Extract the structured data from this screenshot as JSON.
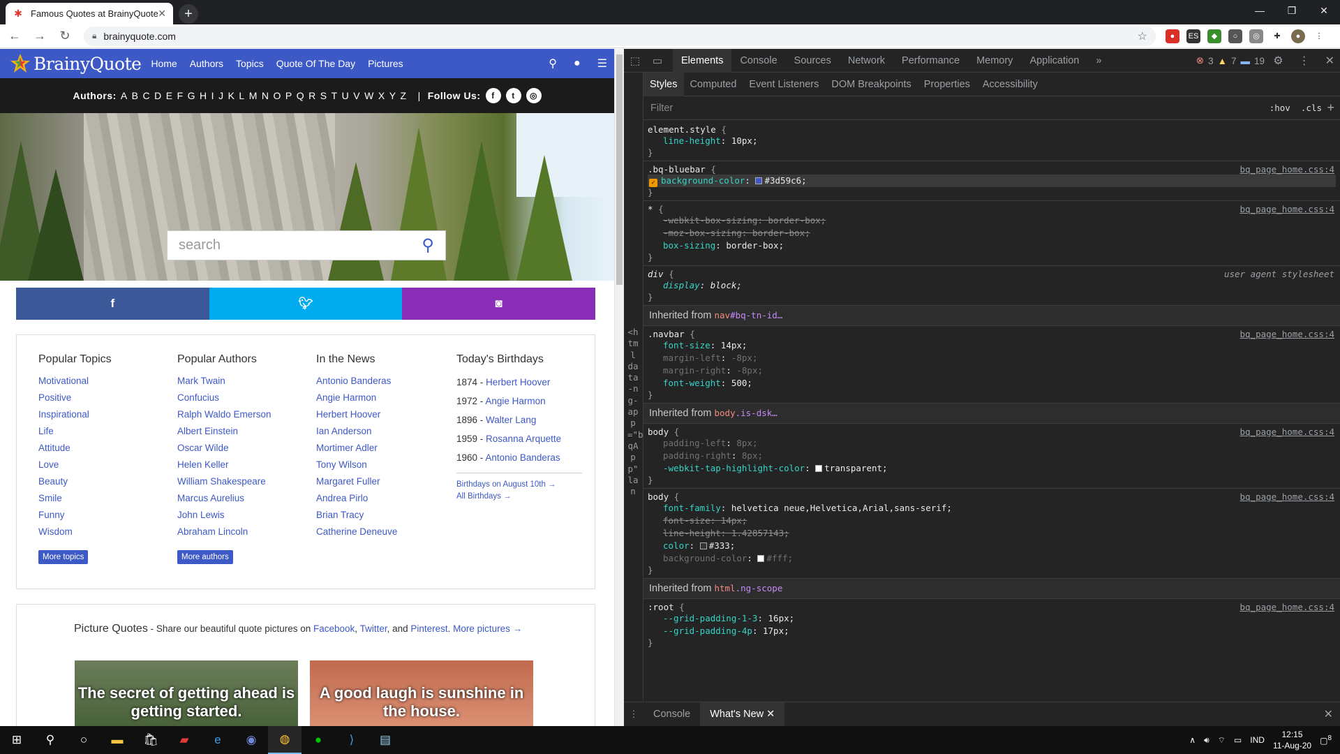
{
  "browser": {
    "tab_title": "Famous Quotes at BrainyQuote",
    "url": "brainyquote.com"
  },
  "site": {
    "logo_text": "BrainyQuote",
    "nav": [
      "Home",
      "Authors",
      "Topics",
      "Quote Of The Day",
      "Pictures"
    ],
    "authors_label": "Authors:",
    "letters": [
      "A",
      "B",
      "C",
      "D",
      "E",
      "F",
      "G",
      "H",
      "I",
      "J",
      "K",
      "L",
      "M",
      "N",
      "O",
      "P",
      "Q",
      "R",
      "S",
      "T",
      "U",
      "V",
      "W",
      "X",
      "Y",
      "Z"
    ],
    "follow_label": "Follow Us:",
    "search_placeholder": "search",
    "columns": {
      "topics": {
        "title": "Popular Topics",
        "items": [
          "Motivational",
          "Positive",
          "Inspirational",
          "Life",
          "Attitude",
          "Love",
          "Beauty",
          "Smile",
          "Funny",
          "Wisdom"
        ],
        "more": "More topics"
      },
      "authors": {
        "title": "Popular Authors",
        "items": [
          "Mark Twain",
          "Confucius",
          "Ralph Waldo Emerson",
          "Albert Einstein",
          "Oscar Wilde",
          "Helen Keller",
          "William Shakespeare",
          "Marcus Aurelius",
          "John Lewis",
          "Abraham Lincoln"
        ],
        "more": "More authors"
      },
      "news": {
        "title": "In the News",
        "items": [
          "Antonio Banderas",
          "Angie Harmon",
          "Herbert Hoover",
          "Ian Anderson",
          "Mortimer Adler",
          "Tony Wilson",
          "Margaret Fuller",
          "Andrea Pirlo",
          "Brian Tracy",
          "Catherine Deneuve"
        ]
      },
      "birthdays": {
        "title": "Today's Birthdays",
        "items": [
          {
            "year": "1874",
            "name": "Herbert Hoover"
          },
          {
            "year": "1972",
            "name": "Angie Harmon"
          },
          {
            "year": "1896",
            "name": "Walter Lang"
          },
          {
            "year": "1959",
            "name": "Rosanna Arquette"
          },
          {
            "year": "1960",
            "name": "Antonio Banderas"
          }
        ],
        "link1": "Birthdays on August 10th →",
        "link2": "All Birthdays →"
      }
    },
    "picture_quotes": {
      "heading": "Picture Quotes",
      "text": "Share our beautiful quote pictures on",
      "links": [
        "Facebook",
        "Twitter",
        "Pinterest",
        "More pictures →"
      ],
      "quote1": "The secret of getting ahead is getting started.",
      "quote2": "A good laugh is sunshine in the house."
    }
  },
  "devtools": {
    "tabs": [
      "Elements",
      "Console",
      "Sources",
      "Network",
      "Performance",
      "Memory",
      "Application"
    ],
    "errors": "3",
    "warnings": "7",
    "messages": "19",
    "subtabs": [
      "Styles",
      "Computed",
      "Event Listeners",
      "DOM Breakpoints",
      "Properties",
      "Accessibility"
    ],
    "filter_placeholder": "Filter",
    "hov": ":hov",
    "cls": ".cls",
    "vertical_path": "<html data-ng-app=\"bqApp\" lan",
    "drawer_tabs": [
      "Console",
      "What's New"
    ]
  },
  "taskbar": {
    "lang": "IND",
    "time": "12:15",
    "date": "11-Aug-20",
    "notif": "8"
  },
  "colors": {
    "brand_blue": "#3d59c6",
    "facebook": "#3b5998",
    "twitter": "#00aced",
    "instagram": "#8a2eb7"
  }
}
